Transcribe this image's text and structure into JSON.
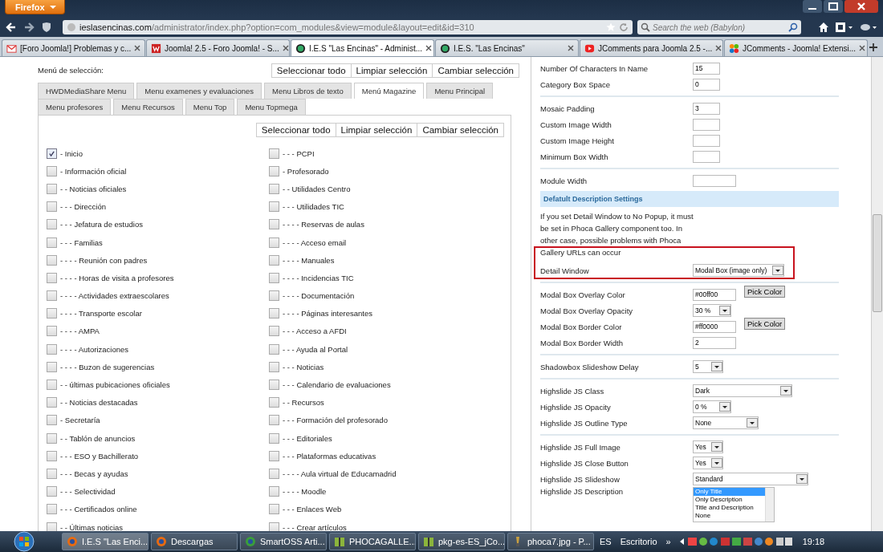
{
  "browser": {
    "menu_button": "Firefox",
    "url_host": "ieslasencinas.com",
    "url_path": "/administrator/index.php?option=com_modules&view=module&layout=edit&id=310",
    "search_placeholder": "Search the web (Babylon)",
    "tabs": [
      {
        "title": "[Foro Joomla!] Problemas y c...",
        "selected": false
      },
      {
        "title": "Joomla! 2.5 - Foro Joomla! - S...",
        "selected": false
      },
      {
        "title": "I.E.S \"Las Encinas\" - Administ...",
        "selected": true
      },
      {
        "title": "I.E.S. \"Las Encinas\"",
        "selected": false
      },
      {
        "title": "JComments para Joomla 2.5 -...",
        "selected": false
      },
      {
        "title": "JComments - Joomla! Extensi...",
        "selected": false
      }
    ]
  },
  "left": {
    "label": "Menú de selección:",
    "buttons": [
      "Seleccionar todo",
      "Limpiar selección",
      "Cambiar selección"
    ],
    "tab_rows": [
      [
        {
          "label": "HWDMediaShare Menu",
          "selected": false
        },
        {
          "label": "Menu examenes y evaluaciones",
          "selected": false
        },
        {
          "label": "Menu Libros de texto",
          "selected": false
        },
        {
          "label": "Menú Magazine",
          "selected": true
        },
        {
          "label": "Menu Principal",
          "selected": false
        }
      ],
      [
        {
          "label": "Menu profesores",
          "selected": false
        },
        {
          "label": "Menu Recursos",
          "selected": false
        },
        {
          "label": "Menu Top",
          "selected": false
        },
        {
          "label": "Menu Topmega",
          "selected": false
        }
      ]
    ],
    "panel_buttons": [
      "Seleccionar todo",
      "Limpiar selección",
      "Cambiar selección"
    ],
    "columns": [
      [
        {
          "label": "- Inicio",
          "checked": true
        },
        {
          "label": "- Información oficial",
          "checked": false
        },
        {
          "label": "- - Noticias oficiales",
          "checked": false
        },
        {
          "label": "- - - Dirección",
          "checked": false
        },
        {
          "label": "- - - Jefatura de estudios",
          "checked": false
        },
        {
          "label": "- - - Familias",
          "checked": false
        },
        {
          "label": "- - - - Reunión con padres",
          "checked": false
        },
        {
          "label": "- - - - Horas de visita a profesores",
          "checked": false
        },
        {
          "label": "- - - - Actividades extraescolares",
          "checked": false
        },
        {
          "label": "- - - - Transporte escolar",
          "checked": false
        },
        {
          "label": "- - - - AMPA",
          "checked": false
        },
        {
          "label": "- - - - Autorizaciones",
          "checked": false
        },
        {
          "label": "- - - - Buzon de sugerencias",
          "checked": false
        },
        {
          "label": "- - últimas pubicaciones oficiales",
          "checked": false
        },
        {
          "label": "- - Noticias destacadas",
          "checked": false
        },
        {
          "label": "- Secretaría",
          "checked": false
        },
        {
          "label": "- - Tablón de anuncios",
          "checked": false
        },
        {
          "label": "- - - ESO y Bachillerato",
          "checked": false
        },
        {
          "label": "- - - Becas y ayudas",
          "checked": false
        },
        {
          "label": "- - - Selectividad",
          "checked": false
        },
        {
          "label": "- - - Certificados online",
          "checked": false
        },
        {
          "label": "- - Últimas noticias",
          "checked": false
        }
      ],
      [
        {
          "label": "- - - PCPI",
          "checked": false
        },
        {
          "label": "- Profesorado",
          "checked": false
        },
        {
          "label": "- - Utilidades Centro",
          "checked": false
        },
        {
          "label": "- - - Utilidades TIC",
          "checked": false
        },
        {
          "label": "- - - - Reservas de aulas",
          "checked": false
        },
        {
          "label": "- - - - Acceso email",
          "checked": false
        },
        {
          "label": "- - - - Manuales",
          "checked": false
        },
        {
          "label": "- - - - Incidencias TIC",
          "checked": false
        },
        {
          "label": "- - - - Documentación",
          "checked": false
        },
        {
          "label": "- - - - Páginas interesantes",
          "checked": false
        },
        {
          "label": "- - - Acceso a AFDI",
          "checked": false
        },
        {
          "label": "- - - Ayuda al Portal",
          "checked": false
        },
        {
          "label": "- - - Noticias",
          "checked": false
        },
        {
          "label": "- - - Calendario de evaluaciones",
          "checked": false
        },
        {
          "label": "- - Recursos",
          "checked": false
        },
        {
          "label": "- - - Formación del profesorado",
          "checked": false
        },
        {
          "label": "- - - Editoriales",
          "checked": false
        },
        {
          "label": "- - - Plataformas educativas",
          "checked": false
        },
        {
          "label": "- - - - Aula virtual de Educamadrid",
          "checked": false
        },
        {
          "label": "- - - - Moodle",
          "checked": false
        },
        {
          "label": "- - - Enlaces Web",
          "checked": false
        },
        {
          "label": "- - - Crear artículos",
          "checked": false
        }
      ]
    ]
  },
  "right": {
    "rows": [
      {
        "kind": "input",
        "label": "Number Of Characters In Name",
        "value": "15"
      },
      {
        "kind": "input",
        "label": "Category Box Space",
        "value": "0"
      },
      {
        "kind": "divider"
      },
      {
        "kind": "input",
        "label": "Mosaic Padding",
        "value": "3"
      },
      {
        "kind": "input",
        "label": "Custom Image Width"
      },
      {
        "kind": "input",
        "label": "Custom Image Height"
      },
      {
        "kind": "input",
        "label": "Minimum Box Width"
      },
      {
        "kind": "divider"
      },
      {
        "kind": "input",
        "label": "Module Width"
      },
      {
        "kind": "section",
        "label": "Defatult Description Settings"
      },
      {
        "kind": "note",
        "text": "If you set Detail Window to No Popup, it must be set in Phoca Gallery component too. In other case, possible problems with Phoca Gallery URLs can occur"
      },
      {
        "kind": "select",
        "label": "Detail Window",
        "value": "Modal Box (image only)",
        "highlighted": true
      },
      {
        "kind": "divider"
      },
      {
        "kind": "color",
        "label": "Modal Box Overlay Color",
        "value": "#00ff00",
        "button": "Pick Color"
      },
      {
        "kind": "select",
        "label": "Modal Box Overlay Opacity",
        "value": "30 %"
      },
      {
        "kind": "color",
        "label": "Modal Box Border Color",
        "value": "#ff0000",
        "button": "Pick Color"
      },
      {
        "kind": "input",
        "label": "Modal Box Border Width",
        "value": "2"
      },
      {
        "kind": "divider"
      },
      {
        "kind": "select",
        "label": "Shadowbox Slideshow Delay",
        "value": "5"
      },
      {
        "kind": "divider"
      },
      {
        "kind": "select",
        "label": "Highslide JS Class",
        "value": "Dark"
      },
      {
        "kind": "select",
        "label": "Highslide JS Opacity",
        "value": "0 %"
      },
      {
        "kind": "select",
        "label": "Highslide JS Outline Type",
        "value": "None"
      },
      {
        "kind": "divider"
      },
      {
        "kind": "select",
        "label": "Highslide JS Full Image",
        "value": "Yes"
      },
      {
        "kind": "select",
        "label": "Highslide JS Close Button",
        "value": "Yes"
      },
      {
        "kind": "select",
        "label": "Highslide JS Slideshow",
        "value": "Standard"
      },
      {
        "kind": "listbox",
        "label": "Highslide JS Description",
        "options": [
          {
            "label": "Only Title",
            "selected": true
          },
          {
            "label": "Only Description",
            "selected": false
          },
          {
            "label": "Title and Description",
            "selected": false
          },
          {
            "label": "None",
            "selected": false
          }
        ]
      }
    ]
  },
  "taskbar": {
    "buttons": [
      {
        "label": "I.E.S \"Las Enci...",
        "selected": true
      },
      {
        "label": "Descargas",
        "selected": false
      },
      {
        "label": "SmartOSS Arti...",
        "selected": false
      },
      {
        "label": "PHOCAGALLE...",
        "selected": false
      },
      {
        "label": "pkg-es-ES_jCo...",
        "selected": false
      },
      {
        "label": "phoca7.jpg - P...",
        "selected": false
      }
    ],
    "language": "ES",
    "desktop": "Escritorio",
    "chevron": "»",
    "time": "19:18"
  }
}
